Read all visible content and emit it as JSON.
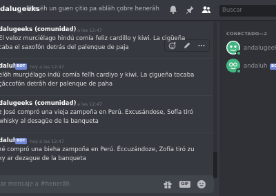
{
  "header": {
    "channel_name": "dalugeeks",
    "topic": "Ètte êh un guen çitio pa ablâh çobre henerâh",
    "search_placeholder": "Buscar",
    "icons": [
      "bell-icon",
      "pin-icon",
      "members-icon"
    ]
  },
  "messages": [
    {
      "author": "dalugeeks (comunidad)",
      "timestamp": "hoy a las 12:47",
      "lines": [
        "El veloz murciélago hindú comía feliz cardillo y kiwi. La cigüeña",
        "caba el saxofón detrás del palenque de paja"
      ]
    },
    {
      "author": "daluh",
      "bot_tag": "BOT",
      "timestamp": "hoy a las 12:47",
      "lines": [
        "elôh murçiélago indú comía felîh cardiyo y kiwi. La çigueña tocaba",
        "çâccofón detrâh der palenque de paha"
      ]
    },
    {
      "author": "dalugeeks (comunidad)",
      "timestamp": "hoy a las 12:47",
      "lines": [
        "z José compró una vieja zampoña en Perú. Excusándose, Sofía tiró",
        "whisky al desagüe de la banqueta"
      ]
    },
    {
      "author": "daluh",
      "bot_tag": "BOT",
      "timestamp": "hoy a las 12:47",
      "lines": [
        "zé compró una bieha zampoña en Perú. Êccuzándoze, Zofía tiró zu",
        "ky ar dezague de la banqueta"
      ]
    }
  ],
  "composer": {
    "placeholder": "iar mensaje a #henerâh",
    "gif_label": "GIF"
  },
  "members": {
    "heading": "CONECTADO—2",
    "list": [
      {
        "name": "andalugeeks",
        "bot": false
      },
      {
        "name": "andaluh",
        "bot": true,
        "bot_tag": "BOT"
      }
    ]
  },
  "colors": {
    "background": "#36393f",
    "sidebar": "#2f3136",
    "accent": "#7289da",
    "online": "#43b581"
  }
}
